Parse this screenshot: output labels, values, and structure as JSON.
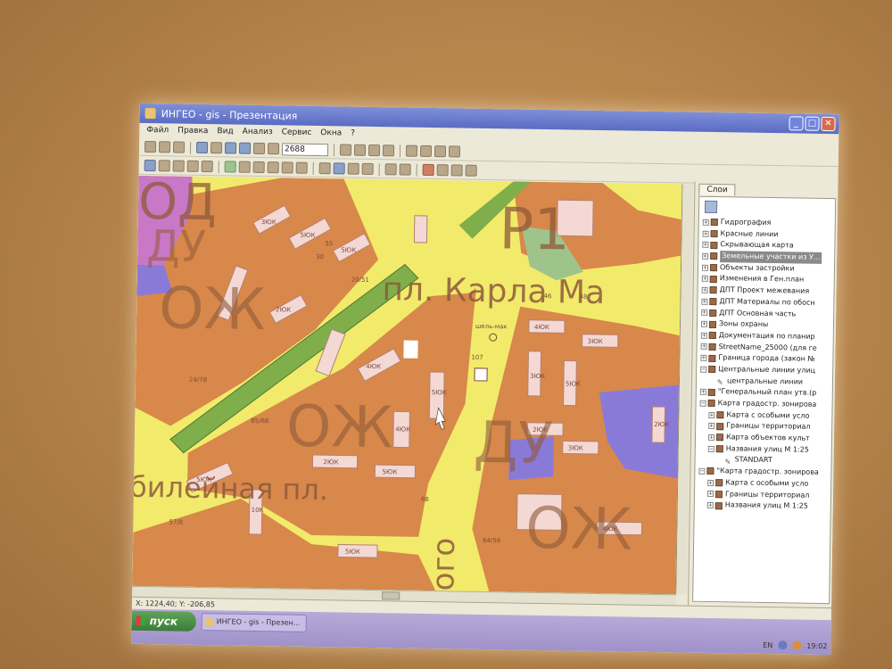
{
  "window": {
    "title": "ИНГЕО - gis - Презентация",
    "buttons": {
      "minimize": "_",
      "maximize": "□",
      "close": "✕"
    }
  },
  "menu": [
    "Файл",
    "Правка",
    "Вид",
    "Анализ",
    "Сервис",
    "Окна",
    "?"
  ],
  "toolbar": {
    "zoom_value": "2688"
  },
  "map": {
    "labels": {
      "district_1": "Р1",
      "square_karla": "пл. Карла Ма",
      "square_yubileynaya": "билейная пл.",
      "zone_ozh_1": "ОЖ",
      "zone_ozh_2": "ОЖ",
      "zone_ozh_3": "ОЖ",
      "zone_du_1": "ДУ",
      "zone_du_2": "ДУ",
      "zone_od": "ОД",
      "street_ogo": "ого",
      "marker_label": "шель-мак"
    },
    "lots": [
      "3ЮК",
      "5ЮК",
      "5ЮК",
      "2ЮК",
      "4ЮК",
      "5ЮК",
      "4ЮК",
      "2ЮК",
      "5ЮК",
      "5ЮК",
      "10К",
      "5ЮК",
      "4ЮК",
      "3ЮК",
      "3ЮК",
      "5ЮК",
      "2ЮК",
      "3ЮК",
      "4ЮК",
      "2ЮК"
    ],
    "numbers": [
      "30",
      "55",
      "20/51",
      "24/78",
      "85/68",
      "57/8",
      "107",
      "64/56",
      "68",
      "46",
      "48"
    ]
  },
  "layers_panel": {
    "tab_label": "Слои",
    "items": [
      {
        "label": "Гидрография",
        "expander": "+",
        "selected": false
      },
      {
        "label": "Красные линии",
        "expander": "+",
        "selected": false
      },
      {
        "label": "Скрывающая карта",
        "expander": "+",
        "selected": false
      },
      {
        "label": "Земельные участки из У...",
        "expander": "+",
        "selected": true
      },
      {
        "label": "Объекты застройки",
        "expander": "+",
        "selected": false
      },
      {
        "label": "Изменения в Ген.план",
        "expander": "+",
        "selected": false
      },
      {
        "label": "ДПТ Проект межевания",
        "expander": "+",
        "selected": false
      },
      {
        "label": "ДПТ Материалы по обосн",
        "expander": "+",
        "selected": false
      },
      {
        "label": "ДПТ Основная часть",
        "expander": "+",
        "selected": false
      },
      {
        "label": "Зоны охраны",
        "expander": "+",
        "selected": false
      },
      {
        "label": "Документация по планир",
        "expander": "+",
        "selected": false
      },
      {
        "label": "StreetName_25000 (для ге",
        "expander": "+",
        "selected": false
      },
      {
        "label": "Граница города (закон №",
        "expander": "+",
        "selected": false
      },
      {
        "label": "Центральные линии улиц",
        "expander": "−",
        "selected": false
      },
      {
        "label": "центральные линии",
        "expander": "",
        "selected": false,
        "indent": 1,
        "pencil": true
      },
      {
        "label": "\"Генеральный план утв.(р",
        "expander": "+",
        "selected": false
      },
      {
        "label": "Карта градостр. зонирова",
        "expander": "−",
        "selected": false
      },
      {
        "label": "Карта с особыми усло",
        "expander": "+",
        "selected": false,
        "indent": 1
      },
      {
        "label": "Границы территориал",
        "expander": "+",
        "selected": false,
        "indent": 1
      },
      {
        "label": "Карта объектов культ",
        "expander": "+",
        "selected": false,
        "indent": 1
      },
      {
        "label": "Названия улиц М 1:25",
        "expander": "−",
        "selected": false,
        "indent": 1
      },
      {
        "label": "STANDART",
        "expander": "",
        "selected": false,
        "indent": 2,
        "pencil": true
      },
      {
        "label": "\"Карта градостр. зонирова",
        "expander": "−",
        "selected": false
      },
      {
        "label": "Карта с особыми усло",
        "expander": "+",
        "selected": false,
        "indent": 1
      },
      {
        "label": "Границы территориал",
        "expander": "+",
        "selected": false,
        "indent": 1
      },
      {
        "label": "Названия улиц М 1:25",
        "expander": "+",
        "selected": false,
        "indent": 1
      }
    ]
  },
  "statusbar": {
    "coords": "X: 1224,40; Y: -206,85"
  },
  "taskbar": {
    "start_label": "пуск",
    "task_label": "ИНГЕО - gis - Презен...",
    "lang": "EN",
    "clock": "19:02"
  },
  "colors": {
    "map_yellow": "#f2ea6b",
    "residential_orange": "#d8884a",
    "lot_pink": "#f4d8d4",
    "green_strip": "#7fae4a",
    "purple_zone": "#8a7ad8",
    "selection_gray": "#8a8a8a"
  }
}
